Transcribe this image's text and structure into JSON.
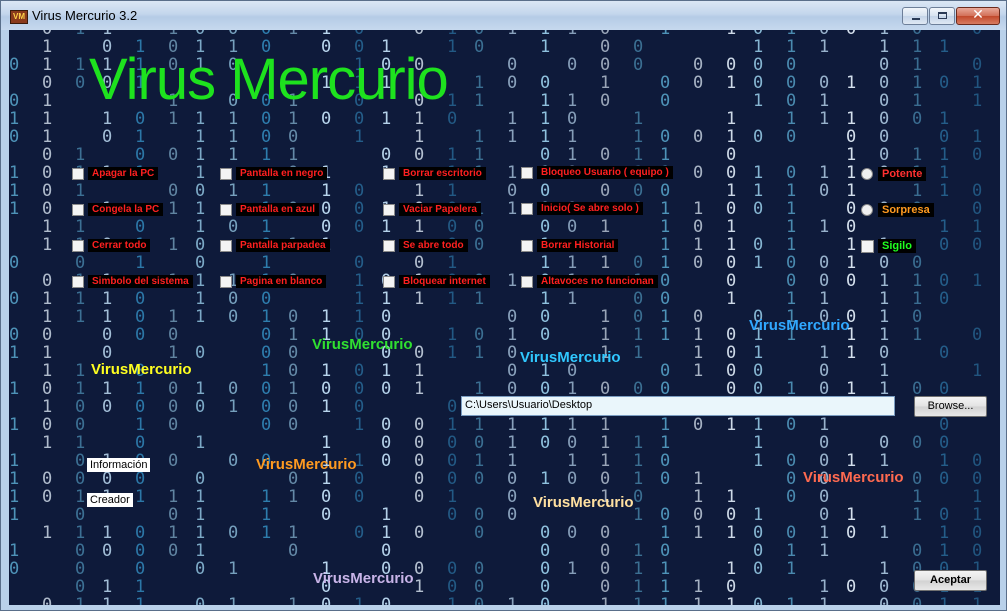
{
  "window": {
    "title": "Virus Mercurio 3.2",
    "icon_text": "VM",
    "close_glyph": "✕"
  },
  "header": {
    "title": "Virus Mercurio",
    "title_color": "#1ee21e"
  },
  "checkboxes": {
    "col1": [
      "Apagar la PC",
      "Congela la PC",
      "Cerrar todo",
      "Simbolo del sistema"
    ],
    "col2": [
      "Pantalla en negro",
      "Pantalla en azul",
      "Pantalla parpadea",
      "Pagina en blanco"
    ],
    "col3": [
      "Borrar escritorio",
      "Vaciar Papelera",
      "Se abre todo",
      "Bloquear internet"
    ],
    "col4": [
      "Bloqueo Usuario ( equipo )",
      "Inicio( Se abre solo )",
      "Borrar Historial",
      "Altavoces no funcionan"
    ]
  },
  "options": {
    "potente": {
      "label": "Potente",
      "color": "#ff3030"
    },
    "sorpresa": {
      "label": "Sorpresa",
      "color": "#ff9a20"
    },
    "sigilo": {
      "label": "Sigilo",
      "color": "#20ff20"
    }
  },
  "watermarks": {
    "text": "VirusMercurio",
    "colors": [
      "#ffff20",
      "#30e030",
      "#30c8ff",
      "#30a8ff",
      "#ff9a20",
      "#ffe0a0",
      "#ff6a50",
      "#c8b4e8"
    ]
  },
  "path": {
    "value": "C:\\Users\\Usuario\\Desktop"
  },
  "buttons": {
    "browse": "Browse...",
    "accept": "Aceptar"
  },
  "labels": {
    "info": "Información",
    "creator": "Creador"
  }
}
